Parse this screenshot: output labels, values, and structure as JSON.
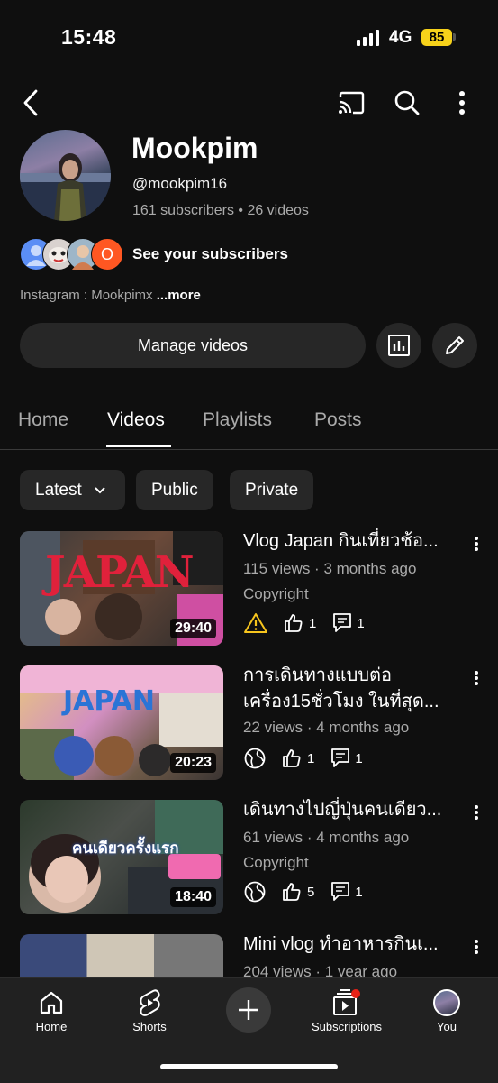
{
  "status_bar": {
    "time": "15:48",
    "network": "4G",
    "battery": "85"
  },
  "channel": {
    "name": "Mookpim",
    "handle": "@mookpim16",
    "stats": "161 subscribers • 26 videos",
    "see_subscribers": "See your subscribers",
    "subscriber_badge": "O",
    "description": "Instagram : Mookpimx",
    "more": "...more",
    "manage_button": "Manage videos"
  },
  "tabs": [
    {
      "label": "Home"
    },
    {
      "label": "Videos"
    },
    {
      "label": "Playlists"
    },
    {
      "label": "Posts"
    }
  ],
  "filters": [
    {
      "label": "Latest"
    },
    {
      "label": "Public"
    },
    {
      "label": "Private"
    }
  ],
  "videos": [
    {
      "title": "Vlog Japan กินเที่ยวช้อ...",
      "meta": "115 views · 3 months ago",
      "extra": "Copyright",
      "duration": "29:40",
      "thumb_text": "JAPAN",
      "likes": "1",
      "comments": "1",
      "status_icon": "warning-icon"
    },
    {
      "title_line1": "การเดินทางแบบต่อ",
      "title_line2": "เครื่อง15ชั่วโมง ในที่สุด...",
      "meta": "22 views · 4 months ago",
      "duration": "20:23",
      "thumb_text": "JAPAN",
      "likes": "1",
      "comments": "1",
      "status_icon": "globe-icon"
    },
    {
      "title": "เดินทางไปญี่ปุ่นคนเดียว...",
      "meta": "61 views · 4 months ago",
      "extra": "Copyright",
      "duration": "18:40",
      "thumb_text": "คนเดียวครั้งแรก",
      "likes": "5",
      "comments": "1",
      "status_icon": "globe-icon"
    },
    {
      "title": "Mini vlog ทำอาหารกินเ...",
      "meta": "204 views · 1 year ago"
    }
  ],
  "bottom_nav": [
    {
      "label": "Home",
      "icon": "home-icon"
    },
    {
      "label": "Shorts",
      "icon": "shorts-icon"
    },
    {
      "label": "",
      "icon": "create-icon"
    },
    {
      "label": "Subscriptions",
      "icon": "subscriptions-icon"
    },
    {
      "label": "You",
      "icon": "you-avatar"
    }
  ],
  "colors": {
    "background": "#0f0f0f",
    "chip": "#272727",
    "battery": "#f7d21a",
    "notification": "#e62117",
    "warning": "#f7c51d"
  }
}
